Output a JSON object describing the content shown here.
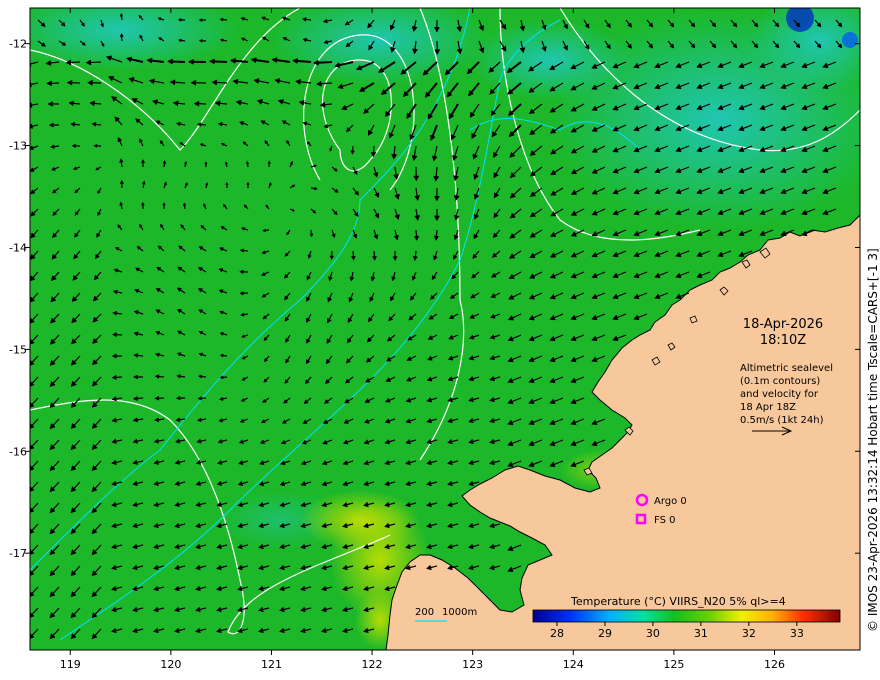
{
  "map": {
    "x_ticks": [
      "119",
      "120",
      "121",
      "122",
      "123",
      "124",
      "125",
      "126"
    ],
    "y_ticks": [
      "-12",
      "-13",
      "-14",
      "-15",
      "-16",
      "-17"
    ],
    "x_tick_values": [
      119,
      120,
      121,
      122,
      123,
      124,
      125,
      126
    ],
    "y_tick_values": [
      -12,
      -13,
      -14,
      -15,
      -16,
      -17
    ],
    "lon_range": [
      118.6,
      126.85
    ],
    "lat_range": [
      -17.95,
      -11.65
    ]
  },
  "annotation": {
    "date": "18-Apr-2026",
    "time": "18:10Z",
    "lines": [
      "Altimetric sealevel",
      "(0.1m contours)",
      "and velocity for",
      "18 Apr 18Z",
      "0.5m/s (1kt 24h)"
    ]
  },
  "legend": {
    "argo_label": "Argo 0",
    "fs_label": "FS 0",
    "argo_color": "#ff00ff",
    "fs_color": "#ff00ff"
  },
  "depth_legend": {
    "label1": "200",
    "label2": "1000m",
    "color": "#00ffff"
  },
  "colorbar": {
    "title": "Temperature (°C) VIIRS_N20 5% ql>=4",
    "ticks": [
      "28",
      "29",
      "30",
      "31",
      "32",
      "33"
    ],
    "tick_values": [
      28,
      29,
      30,
      31,
      32,
      33
    ],
    "range": [
      27.5,
      33.9
    ]
  },
  "copyright": "© IMOS 23-Apr-2026 13:32:14 Hobart time Tscale=CARS+[-1 3]",
  "colors": {
    "ocean": "#1cb829",
    "land": "#f7c89b",
    "contour": "#ffffff",
    "isobath": "#00ffff",
    "arrow": "#000000"
  }
}
